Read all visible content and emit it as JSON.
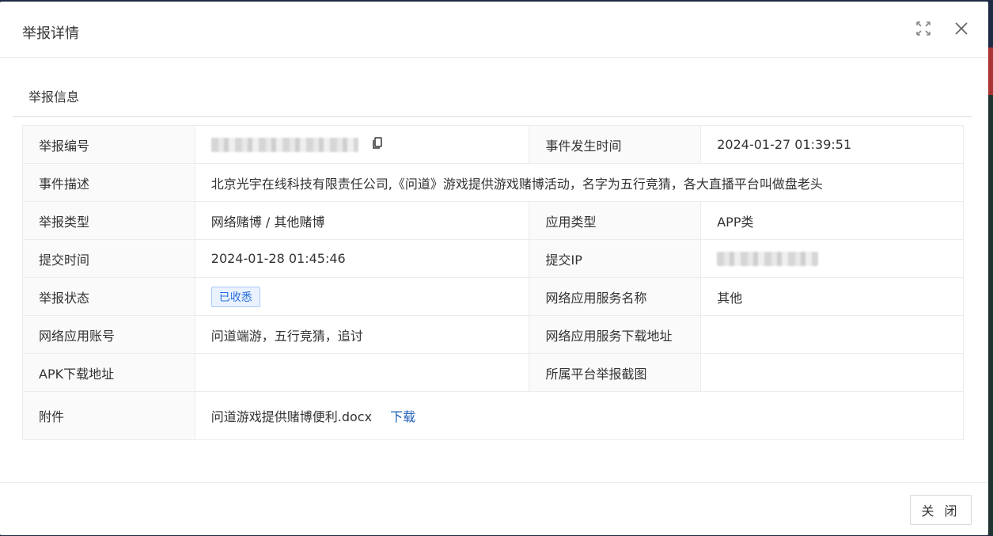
{
  "modal": {
    "title": "举报详情",
    "section_title": "举报信息",
    "close_button": "关 闭"
  },
  "details": {
    "report_id_label": "举报编号",
    "event_time_label": "事件发生时间",
    "event_time": "2024-01-27 01:39:51",
    "description_label": "事件描述",
    "description": "北京光宇在线科技有限责任公司,《问道》游戏提供游戏赌博活动，名字为五行竞猜，各大直播平台叫做盘老头",
    "report_type_label": "举报类型",
    "report_type": "网络赌博 / 其他赌博",
    "app_type_label": "应用类型",
    "app_type": "APP类",
    "submit_time_label": "提交时间",
    "submit_time": "2024-01-28 01:45:46",
    "submit_ip_label": "提交IP",
    "status_label": "举报状态",
    "status": "已收悉",
    "service_name_label": "网络应用服务名称",
    "service_name": "其他",
    "account_label": "网络应用账号",
    "account": "问道端游，五行竞猜，追讨",
    "service_download_label": "网络应用服务下载地址",
    "apk_label": "APK下载地址",
    "screenshot_label": "所属平台举报截图",
    "attachment_label": "附件",
    "attachment_name": "问道游戏提供赌博便利.docx",
    "download_link": "下载"
  },
  "icons": {
    "fullscreen": "fullscreen-icon",
    "close": "close-icon",
    "copy": "copy-icon"
  },
  "colors": {
    "status_tag": "#2a6edb",
    "link": "#1f5fb7"
  }
}
